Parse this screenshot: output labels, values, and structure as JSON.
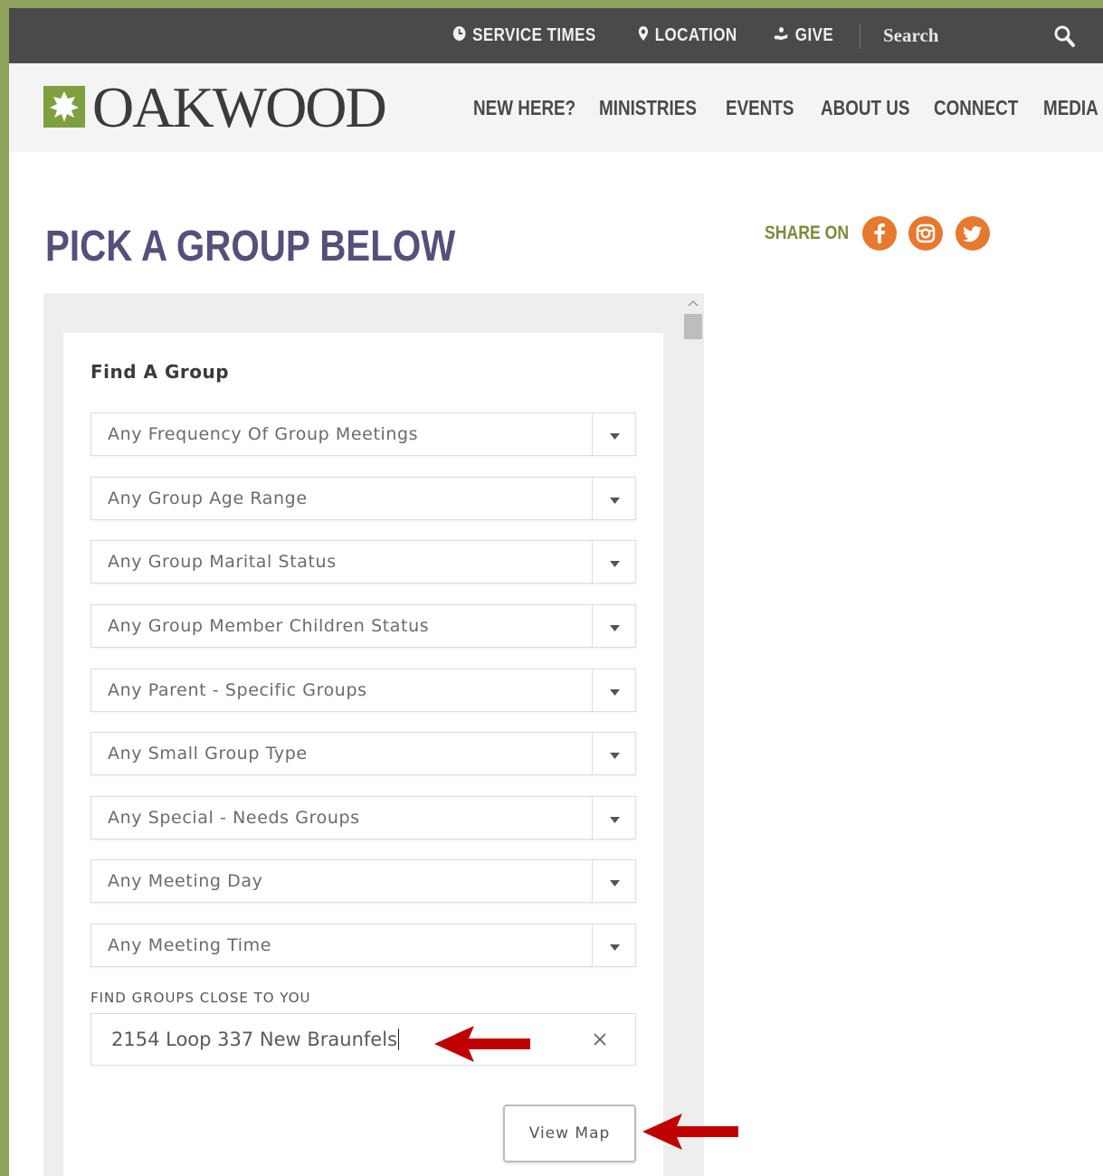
{
  "topbar": {
    "service_times": "SERVICE TIMES",
    "location": "LOCATION",
    "give": "GIVE",
    "search_placeholder": "Search",
    "icons": [
      "clock-icon",
      "map-pin-icon",
      "give-hand-icon",
      "search-icon"
    ]
  },
  "header": {
    "logo_text": "OAKWOOD",
    "nav": [
      "NEW HERE?",
      "MINISTRIES",
      "EVENTS",
      "ABOUT US",
      "CONNECT",
      "MEDIA"
    ]
  },
  "page": {
    "title": "PICK A GROUP BELOW",
    "share_label": "SHARE ON",
    "social": [
      "facebook-icon",
      "instagram-icon",
      "twitter-icon"
    ],
    "accent_color": "#e7782f",
    "title_color": "#55507a"
  },
  "form": {
    "title": "Find A Group",
    "selects": [
      "Any Frequency Of Group Meetings",
      "Any Group Age Range",
      "Any Group Marital Status",
      "Any Group Member Children Status",
      "Any Parent - Specific Groups",
      "Any Small Group Type",
      "Any Special - Needs Groups",
      "Any Meeting Day",
      "Any Meeting Time"
    ],
    "near_label": "FIND GROUPS CLOSE TO YOU",
    "address_value": "2154 Loop 337 New Braunfels",
    "view_map_label": "View Map"
  },
  "annotations": {
    "arrow_color": "#c00000"
  }
}
